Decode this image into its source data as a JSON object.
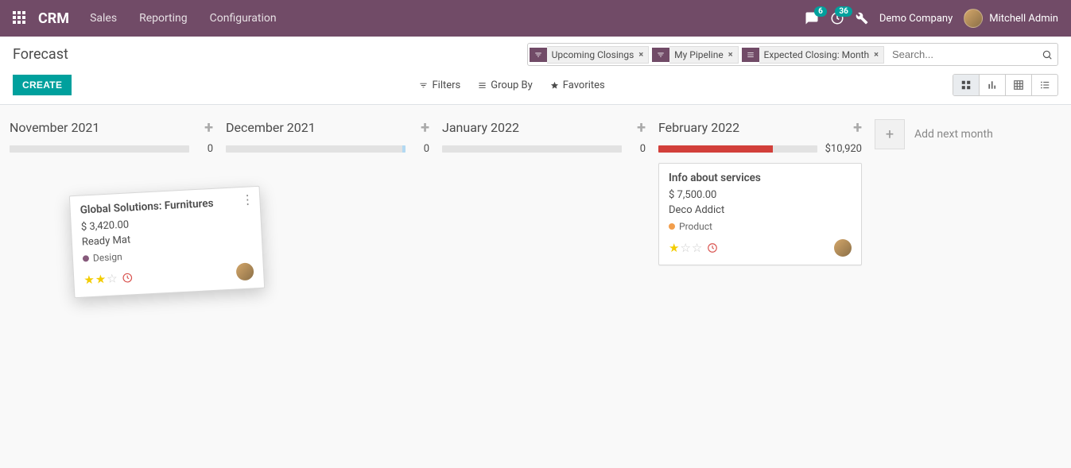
{
  "nav": {
    "brand": "CRM",
    "menu": [
      "Sales",
      "Reporting",
      "Configuration"
    ],
    "chat_badge": "6",
    "activity_badge": "36",
    "company": "Demo Company",
    "user": "Mitchell Admin"
  },
  "panel": {
    "breadcrumb": "Forecast",
    "create_label": "CREATE",
    "facets": [
      {
        "kind": "filter",
        "label": "Upcoming Closings"
      },
      {
        "kind": "filter",
        "label": "My Pipeline"
      },
      {
        "kind": "group",
        "label": "Expected Closing: Month"
      }
    ],
    "search_placeholder": "Search...",
    "filters_label": "Filters",
    "groupby_label": "Group By",
    "favorites_label": "Favorites"
  },
  "columns": [
    {
      "title": "November 2021",
      "amount": "0",
      "fill_pct": 0,
      "blue_tail": false
    },
    {
      "title": "December 2021",
      "amount": "0",
      "fill_pct": 0,
      "blue_tail": true
    },
    {
      "title": "January 2022",
      "amount": "0",
      "fill_pct": 0,
      "blue_tail": false
    },
    {
      "title": "February 2022",
      "amount": "$10,920",
      "fill_pct": 72,
      "blue_tail": false
    }
  ],
  "add_month_label": "Add next month",
  "feb_card": {
    "title": "Info about services",
    "amount": "$ 7,500.00",
    "customer": "Deco Addict",
    "tag": "Product",
    "tag_color": "#f29e4c",
    "stars": 1
  },
  "drag_card": {
    "title": "Global Solutions: Furnitures",
    "amount": "$ 3,420.00",
    "customer": "Ready Mat",
    "tag": "Design",
    "tag_color": "#875a7b",
    "stars": 2
  }
}
